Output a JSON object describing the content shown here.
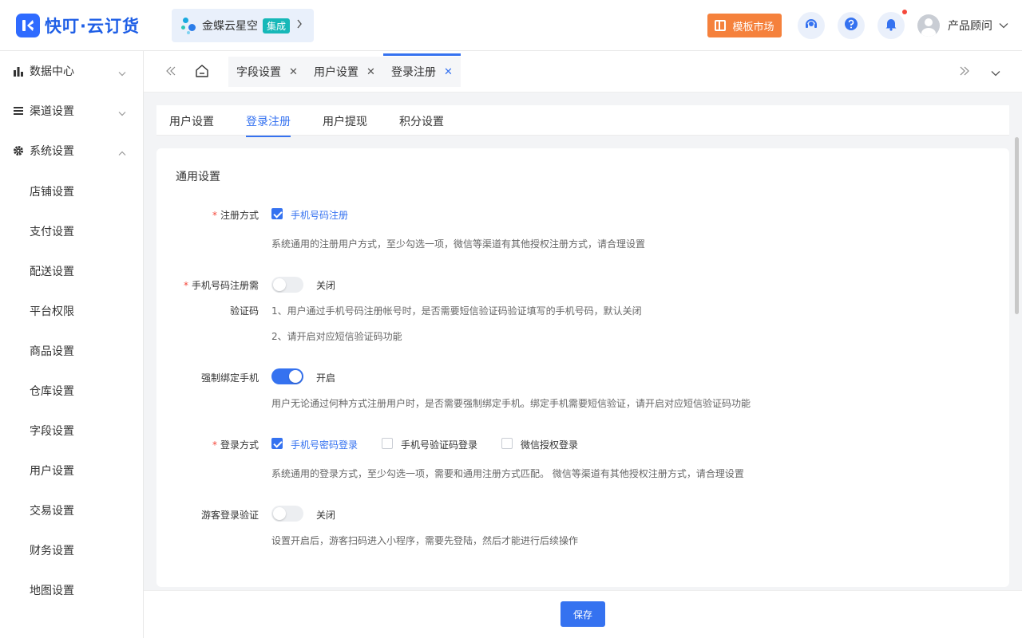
{
  "brand": {
    "name": "快叮·云订货"
  },
  "integration": {
    "name": "金蝶云星空",
    "tag": "集成"
  },
  "header": {
    "market_label": "模板市场",
    "user_name": "产品顾问"
  },
  "sidebar": {
    "groups": [
      {
        "label": "数据中心",
        "icon": "bar-chart-icon"
      },
      {
        "label": "渠道设置",
        "icon": "list-icon"
      },
      {
        "label": "系统设置",
        "icon": "gear-icon"
      }
    ],
    "items": [
      "店铺设置",
      "支付设置",
      "配送设置",
      "平台权限",
      "商品设置",
      "仓库设置",
      "字段设置",
      "用户设置",
      "交易设置",
      "财务设置",
      "地图设置"
    ]
  },
  "tabs": [
    {
      "label": "字段设置"
    },
    {
      "label": "用户设置"
    },
    {
      "label": "登录注册",
      "active": true
    }
  ],
  "subtabs": [
    {
      "label": "用户设置"
    },
    {
      "label": "登录注册",
      "active": true
    },
    {
      "label": "用户提现"
    },
    {
      "label": "积分设置"
    }
  ],
  "section": {
    "title": "通用设置"
  },
  "fields": {
    "register_method": {
      "label": "注册方式",
      "option": "手机号码注册",
      "checked": true,
      "hint": "系统通用的注册用户方式，至少勾选一项，微信等渠道有其他授权注册方式，请合理设置"
    },
    "sms_verify": {
      "label_line1": "手机号码注册需",
      "label_line2": "验证码",
      "state": "关闭",
      "on": false,
      "hint1": "1、用户通过手机号码注册帐号时，是否需要短信验证码验证填写的手机号码，默认关闭",
      "hint2": "2、请开启对应短信验证码功能"
    },
    "bind_phone": {
      "label": "强制绑定手机",
      "state": "开启",
      "on": true,
      "hint": "用户无论通过何种方式注册用户时，是否需要强制绑定手机。绑定手机需要短信验证，请开启对应短信验证码功能"
    },
    "login_method": {
      "label": "登录方式",
      "options": [
        {
          "label": "手机号密码登录",
          "checked": true
        },
        {
          "label": "手机号验证码登录",
          "checked": false
        },
        {
          "label": "微信授权登录",
          "checked": false
        }
      ],
      "hint": "系统通用的登录方式，至少勾选一项，需要和通用注册方式匹配。 微信等渠道有其他授权注册方式，请合理设置"
    },
    "guest_verify": {
      "label": "游客登录验证",
      "state": "关闭",
      "on": false,
      "hint": "设置开启后，游客扫码进入小程序，需要先登陆，然后才能进行后续操作"
    }
  },
  "footer": {
    "save_label": "保存"
  },
  "colors": {
    "primary": "#3572f0",
    "market": "#f5813c",
    "required": "#f5483b"
  }
}
